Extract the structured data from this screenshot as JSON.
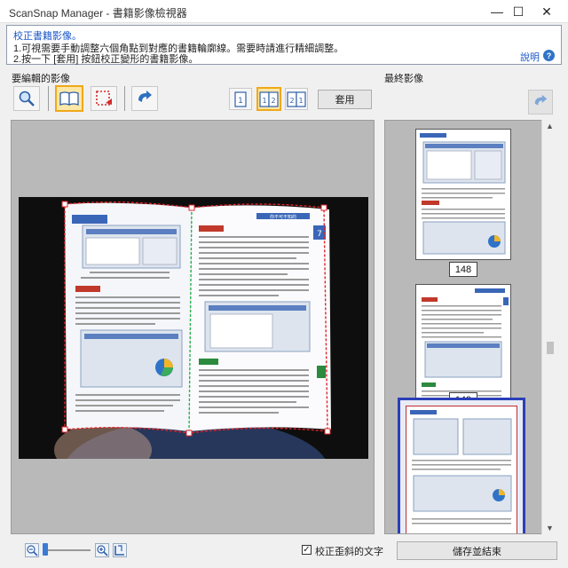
{
  "window": {
    "title": "ScanSnap Manager - 書籍影像檢視器",
    "controls": {
      "minimize": "—",
      "maximize": "☐",
      "close": "✕"
    }
  },
  "info": {
    "heading": "校正書籍影像。",
    "line1": "1.可視需要手動調整六個角點到對應的書籍輪廓線。需要時請進行精細調整。",
    "line2": "2.按一下 [套用] 按鈕校正變形的書籍影像。",
    "help": "說明",
    "help_icon": "?"
  },
  "left_panel": {
    "label": "要編輯的影像",
    "apply": "套用"
  },
  "right_panel": {
    "label": "最終影像",
    "pages": [
      "148",
      "149"
    ]
  },
  "page_spread": {
    "heading_right": "你不可不知的",
    "tab_number": "7"
  },
  "bottom": {
    "checkbox_checked": true,
    "checkbox_mark": "✓",
    "checkbox_label": "校正歪斜的文字",
    "save_exit": "儲存並結束"
  },
  "colors": {
    "accent_blue": "#1a56c8",
    "select_orange": "#f0a81a",
    "guide_red": "#e0262b",
    "guide_green": "#29b34a",
    "thumb_selected": "#2a3fb8"
  }
}
